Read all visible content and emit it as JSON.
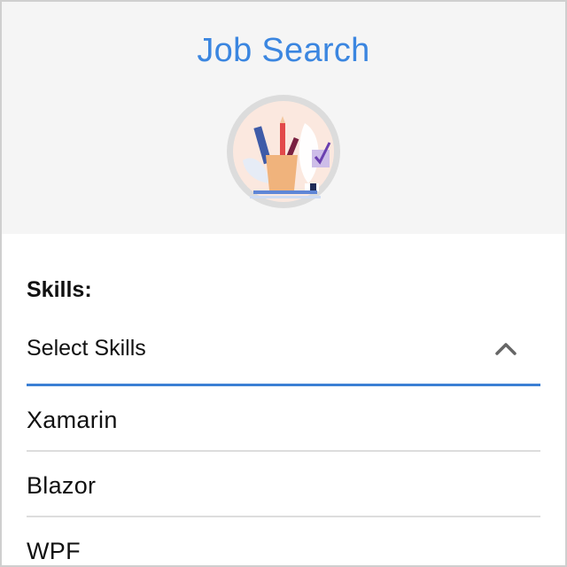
{
  "header": {
    "title": "Job Search",
    "avatar_icon": "desk-supplies-illustration"
  },
  "form": {
    "skills_label": "Skills:",
    "select": {
      "placeholder": "Select Skills",
      "expanded": true,
      "chevron_icon": "chevron-up-icon"
    },
    "options": [
      {
        "label": "Xamarin"
      },
      {
        "label": "Blazor"
      },
      {
        "label": "WPF"
      }
    ]
  },
  "colors": {
    "accent": "#3b86e0",
    "header_bg": "#f5f5f5",
    "underline": "#3b7fd4",
    "divider": "#dddddd"
  }
}
